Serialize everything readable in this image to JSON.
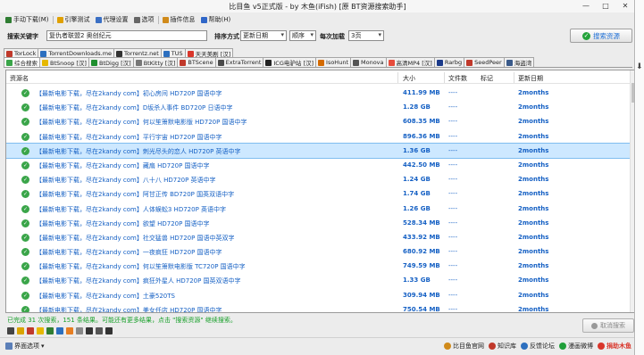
{
  "window": {
    "title": "比目鱼 v5正式版 - by 木鱼(iFish) [原 BT资源搜索助手]",
    "min_glyph": "—",
    "max_glyph": "□",
    "close_glyph": "✕"
  },
  "menu": [
    {
      "label": "手动下载(M)",
      "icon": "download-icon",
      "color": "#2f7d32"
    },
    {
      "label": "引擎测试",
      "icon": "test-icon",
      "color": "#e0a000"
    },
    {
      "label": "代理设置",
      "icon": "proxy-icon",
      "color": "#3a6fc4"
    },
    {
      "label": "选项",
      "icon": "gear-icon",
      "color": "#666666"
    },
    {
      "label": "插件信息",
      "icon": "plugin-icon",
      "color": "#d08a1a"
    },
    {
      "label": "帮助(H)",
      "icon": "help-icon",
      "color": "#2f66c8"
    }
  ],
  "search": {
    "keyword_label": "搜索关键字",
    "keyword_value": "复仇者联盟2 奥创纪元",
    "sort_label": "排序方式",
    "sort_value": "更新日期",
    "order_value": "顺序",
    "perload_label": "每次加载",
    "perload_value": "3页",
    "button_label": "搜索资源"
  },
  "tabs_row1": [
    {
      "label": "TorLock",
      "color": "#c0392b"
    },
    {
      "label": "TorrentDownloads.me",
      "color": "#2c6fbf"
    },
    {
      "label": "Torrentz.net",
      "color": "#333333"
    },
    {
      "label": "TUS",
      "color": "#2c6fbf"
    },
    {
      "label": "天天美剧 [汉]",
      "color": "#d9362b"
    }
  ],
  "tabs_row2": [
    {
      "label": "综合搜索",
      "color": "#3aa549",
      "active": true
    },
    {
      "label": "BtSnoop [汉]",
      "color": "#e6b800"
    },
    {
      "label": "BtDigg [汉]",
      "color": "#1f8f2f"
    },
    {
      "label": "BtKitty [汉]",
      "color": "#777777"
    },
    {
      "label": "BTScene",
      "color": "#c0392b"
    },
    {
      "label": "ExtraTorrent",
      "color": "#4a4a4a"
    },
    {
      "label": "ICG电驴站 [汉]",
      "color": "#222222"
    },
    {
      "label": "IsoHunt",
      "color": "#d46a00"
    },
    {
      "label": "Monova",
      "color": "#555555"
    },
    {
      "label": "高清MP4 [汉]",
      "color": "#e74c3c"
    },
    {
      "label": "Rarbg",
      "color": "#1b3a8a"
    },
    {
      "label": "SeedPeer",
      "color": "#c0392b"
    },
    {
      "label": "海盗湾",
      "color": "#3a5a8a"
    }
  ],
  "columns": {
    "name": "资源名",
    "size": "大小",
    "files": "文件数",
    "tags": "标记",
    "updated": "更新日期"
  },
  "rows": [
    {
      "name": "【最新电影下载，尽在2kandy com】初心房间 HD720P 国语中字",
      "size": "411.99 MB",
      "files": "----",
      "updated": "2months"
    },
    {
      "name": "【最新电影下载，尽在2kandy com】D坂杀人事件 BD720P 日语中字",
      "size": "1.28 GB",
      "files": "----",
      "updated": "2months"
    },
    {
      "name": "【最新电影下载，尽在2kandy com】何以笙箫默电影版 HD720P 国语中字",
      "size": "608.35 MB",
      "files": "----",
      "updated": "2months"
    },
    {
      "name": "【最新电影下载，尽在2kandy com】平行宇宙 HD720P 国语中字",
      "size": "896.36 MB",
      "files": "----",
      "updated": "2months"
    },
    {
      "name": "【最新电影下载，尽在2kandy com】刺光尽头的恋人 HD720P 英语中字",
      "size": "1.36 GB",
      "files": "----",
      "updated": "2months",
      "selected": true
    },
    {
      "name": "【最新电影下载，尽在2kandy com】藏扇 HD720P 国语中字",
      "size": "442.50 MB",
      "files": "----",
      "updated": "2months"
    },
    {
      "name": "【最新电影下载，尽在2kandy com】八十八 HD720P 英语中字",
      "size": "1.24 GB",
      "files": "----",
      "updated": "2months"
    },
    {
      "name": "【最新电影下载，尽在2kandy com】阿甘正传 BD720P 国英双语中字",
      "size": "1.74 GB",
      "files": "----",
      "updated": "2months"
    },
    {
      "name": "【最新电影下载，尽在2kandy com】人体蜈蚣3 HD720P 英语中字",
      "size": "1.26 GB",
      "files": "----",
      "updated": "2months"
    },
    {
      "name": "【最新电影下载，尽在2kandy com】欲望 HD720P 国语中字",
      "size": "528.34 MB",
      "files": "----",
      "updated": "2months"
    },
    {
      "name": "【最新电影下载，尽在2kandy com】社交猛兽 HD720P 国语中英双字",
      "size": "433.92 MB",
      "files": "----",
      "updated": "2months"
    },
    {
      "name": "【最新电影下载，尽在2kandy com】一夜疯狂 HD720P 国语中字",
      "size": "680.92 MB",
      "files": "----",
      "updated": "2months"
    },
    {
      "name": "【最新电影下载，尽在2kandy com】何以笙箫默电影版 TC720P 国语中字",
      "size": "749.59 MB",
      "files": "----",
      "updated": "2months"
    },
    {
      "name": "【最新电影下载，尽在2kandy com】疯狂外星人 HD720P 国英双语中字",
      "size": "1.33 GB",
      "files": "----",
      "updated": "2months"
    },
    {
      "name": "【最新电影下载，尽在2kandy com】土豪520TS",
      "size": "309.94 MB",
      "files": "----",
      "updated": "2months"
    },
    {
      "name": "【最新电影下载，尽在2kandy com】美女任店 HD720P 国语中字",
      "size": "750.54 MB",
      "files": "----",
      "updated": "2months"
    }
  ],
  "status": {
    "text": "已完成 31 次搜索，151 条结果。可能还有更多结果，点击 \"搜索资源\" 继续搜索。",
    "cancel_label": "取消搜索"
  },
  "toolbar_icons": [
    {
      "name": "film-icon",
      "color": "#444444"
    },
    {
      "name": "folder-icon",
      "color": "#d9a400"
    },
    {
      "name": "magnet-icon",
      "color": "#c0392b"
    },
    {
      "name": "bolt-icon",
      "color": "#e6b800"
    },
    {
      "name": "star-icon",
      "color": "#2f7d32"
    },
    {
      "name": "globe-icon",
      "color": "#2c6fbf"
    },
    {
      "name": "flame-icon",
      "color": "#e67e22"
    },
    {
      "name": "heart-icon",
      "color": "#888888"
    },
    {
      "name": "trophy-icon",
      "color": "#333333"
    },
    {
      "name": "puzzle-icon",
      "color": "#555555"
    },
    {
      "name": "text-icon",
      "color": "#333333"
    }
  ],
  "bottom": {
    "view_options": "界面选项",
    "links": [
      {
        "label": "比目鱼官网",
        "color": "#d08a1a"
      },
      {
        "label": "知识库",
        "color": "#c0392b"
      },
      {
        "label": "反馈论坛",
        "color": "#2c6fbf"
      },
      {
        "label": "漫画微博",
        "color": "#1f9f3a"
      },
      {
        "label": "捐助木鱼",
        "color": "#d9362b"
      }
    ]
  }
}
